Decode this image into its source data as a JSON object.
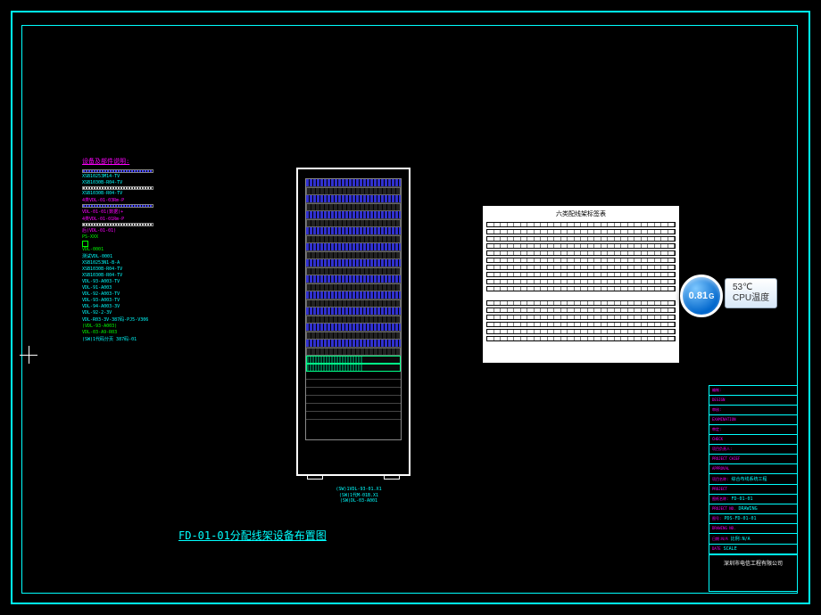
{
  "main_title": "FD-01-01分配线架设备布置图",
  "notes": {
    "title": "设备及部件说明:",
    "items": [
      {
        "text": "XSB10253M14-TV",
        "class": ""
      },
      {
        "text": "XSB1030B-R04-TV",
        "class": ""
      },
      {
        "text": "XSB1030B-R04-TV",
        "class": ""
      },
      {
        "text": "4类VDL-01-03Rm-P",
        "class": "magenta"
      },
      {
        "text": "VDL-01-01(数据)+",
        "class": "magenta"
      },
      {
        "text": "4类VDL-01-01Rm-P",
        "class": "magenta"
      },
      {
        "text": "后(VDL-01-01)",
        "class": "magenta"
      },
      {
        "text": "PS-XXX",
        "class": "green"
      },
      {
        "text": "VDL-0001",
        "class": "green"
      },
      {
        "text": "测试VDL-0001",
        "class": ""
      },
      {
        "text": "XSB10253N1-B-A",
        "class": ""
      },
      {
        "text": "XSB1030B-R04-TV",
        "class": ""
      },
      {
        "text": "XSB1030B-R04-TV",
        "class": ""
      },
      {
        "text": "VDL-93-A003-TV",
        "class": ""
      },
      {
        "text": "VDL-91-A003",
        "class": ""
      },
      {
        "text": "VDL-92-A003-TV",
        "class": ""
      },
      {
        "text": "VDL-93-A003-TV",
        "class": ""
      },
      {
        "text": "VDL-94-A003-3V",
        "class": ""
      },
      {
        "text": "VDL-92-2-3V",
        "class": ""
      },
      {
        "text": "VDL-R03-3V-387码-PJ5-V306",
        "class": ""
      },
      {
        "text": "(VDL-93-A003)",
        "class": "green"
      },
      {
        "text": "VDL-03-A9-R03",
        "class": "green"
      },
      {
        "text": "(SW)1代码分页 387码-01",
        "class": ""
      }
    ]
  },
  "rack": {
    "label1": "(SW)1代M-01B.X1",
    "label2": "(SW)DL-03-A001",
    "label3": "(SW)1VDL-93-01.X1"
  },
  "sheet": {
    "title": "六类配线架标签表",
    "rows": 16
  },
  "title_block": {
    "rows": [
      {
        "label": "编制:",
        "val": ""
      },
      {
        "label": "DESIGN",
        "val": ""
      },
      {
        "label": "审核:",
        "val": ""
      },
      {
        "label": "EXAMINATION",
        "val": ""
      },
      {
        "label": "审定:",
        "val": ""
      },
      {
        "label": "CHECK",
        "val": ""
      },
      {
        "label": "项目负责人:",
        "val": ""
      },
      {
        "label": "PROJECT CHIEF",
        "val": ""
      },
      {
        "label": "APPROVAL",
        "val": ""
      },
      {
        "label": "项目名称:",
        "val": "综合布线系统工程"
      },
      {
        "label": "PROJECT",
        "val": ""
      },
      {
        "label": "图纸名称:",
        "val": "FD-01-01"
      },
      {
        "label": "PROJECT NO.",
        "val": "DRAWING"
      },
      {
        "label": "图号:",
        "val": "PDS-FD-01-01"
      },
      {
        "label": "DRAWING NO.",
        "val": ""
      },
      {
        "label": "日期:N/A",
        "val": "比例:N/A"
      },
      {
        "label": "DATE",
        "val": "SCALE"
      }
    ],
    "company": "深圳市电信工程有限公司"
  },
  "cpu_widget": {
    "value": "0.81",
    "unit": "G",
    "temp_value": "53℃",
    "temp_label": "CPU温度"
  }
}
